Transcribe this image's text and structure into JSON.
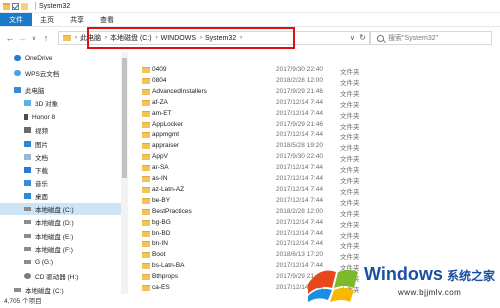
{
  "window": {
    "title": "System32"
  },
  "ribbon": {
    "tabs": [
      "文件",
      "主页",
      "共享",
      "查看"
    ]
  },
  "nav": {
    "back": "←",
    "forward": "→",
    "dropdown": "∨",
    "up": "↑"
  },
  "address": {
    "crumbs": [
      "此电脑",
      "本地磁盘 (C:)",
      "WINDOWS",
      "System32"
    ],
    "dropdown": "∨",
    "refresh": "↻"
  },
  "search": {
    "placeholder": "搜索\"System32\""
  },
  "sidebar": {
    "items": [
      {
        "label": "OneDrive",
        "icon": "cloud-icon"
      },
      {
        "label": "WPS云文档",
        "icon": "wps-cloud-icon"
      },
      {
        "label": "此电脑",
        "icon": "computer-icon"
      },
      {
        "label": "3D 对象",
        "icon": "3d-objects-icon"
      },
      {
        "label": "Honor 8",
        "icon": "phone-icon"
      },
      {
        "label": "视频",
        "icon": "video-icon"
      },
      {
        "label": "图片",
        "icon": "pictures-icon"
      },
      {
        "label": "文档",
        "icon": "documents-icon"
      },
      {
        "label": "下载",
        "icon": "download-icon"
      },
      {
        "label": "音乐",
        "icon": "music-icon"
      },
      {
        "label": "桌面",
        "icon": "desktop-icon"
      },
      {
        "label": "本地磁盘 (C:)",
        "icon": "drive-icon",
        "selected": true
      },
      {
        "label": "本地磁盘 (D:)",
        "icon": "drive-icon"
      },
      {
        "label": "本地磁盘 (E:)",
        "icon": "drive-icon"
      },
      {
        "label": "本地磁盘 (F:)",
        "icon": "drive-icon"
      },
      {
        "label": "G (G:)",
        "icon": "drive-icon"
      },
      {
        "label": "CD 驱动器 (H:)",
        "icon": "cd-drive-icon"
      },
      {
        "label": "本地磁盘 (C:)",
        "icon": "drive-icon"
      }
    ]
  },
  "files": [
    {
      "name": "0409",
      "date": "2017/9/30 22:40",
      "type": "文件夹"
    },
    {
      "name": "0804",
      "date": "2018/2/28 12:00",
      "type": "文件夹"
    },
    {
      "name": "AdvancedInstallers",
      "date": "2017/9/29 21:46",
      "type": "文件夹"
    },
    {
      "name": "af-ZA",
      "date": "2017/12/14 7:44",
      "type": "文件夹"
    },
    {
      "name": "am-ET",
      "date": "2017/12/14 7:44",
      "type": "文件夹"
    },
    {
      "name": "AppLocker",
      "date": "2017/9/29 21:46",
      "type": "文件夹"
    },
    {
      "name": "appmgmt",
      "date": "2017/12/14 7:44",
      "type": "文件夹"
    },
    {
      "name": "appraiser",
      "date": "2018/5/28 19:20",
      "type": "文件夹"
    },
    {
      "name": "AppV",
      "date": "2017/9/30 22:40",
      "type": "文件夹"
    },
    {
      "name": "ar-SA",
      "date": "2017/12/14 7:44",
      "type": "文件夹"
    },
    {
      "name": "as-IN",
      "date": "2017/12/14 7:44",
      "type": "文件夹"
    },
    {
      "name": "az-Latn-AZ",
      "date": "2017/12/14 7:44",
      "type": "文件夹"
    },
    {
      "name": "be-BY",
      "date": "2017/12/14 7:44",
      "type": "文件夹"
    },
    {
      "name": "BestPractices",
      "date": "2018/2/28 12:00",
      "type": "文件夹"
    },
    {
      "name": "bg-BG",
      "date": "2017/12/14 7:44",
      "type": "文件夹"
    },
    {
      "name": "bn-BD",
      "date": "2017/12/14 7:44",
      "type": "文件夹"
    },
    {
      "name": "bn-IN",
      "date": "2017/12/14 7:44",
      "type": "文件夹"
    },
    {
      "name": "Boot",
      "date": "2018/6/13 17:20",
      "type": "文件夹"
    },
    {
      "name": "bs-Latn-BA",
      "date": "2017/12/14 7:44",
      "type": "文件夹"
    },
    {
      "name": "Bthprops",
      "date": "2017/9/29 21:46",
      "type": "文件夹"
    },
    {
      "name": "ca-ES",
      "date": "2017/12/14 7:44",
      "type": "文件夹"
    }
  ],
  "status": {
    "count": "4,705 个项目"
  },
  "watermark": {
    "brand": "Windows",
    "suffix": "系统之家",
    "url": "www.bjjmlv.com"
  },
  "colors": {
    "accent": "#1979ca",
    "highlight": "#e01010",
    "folder": "#f3c35a",
    "selection": "#cde4f7"
  }
}
